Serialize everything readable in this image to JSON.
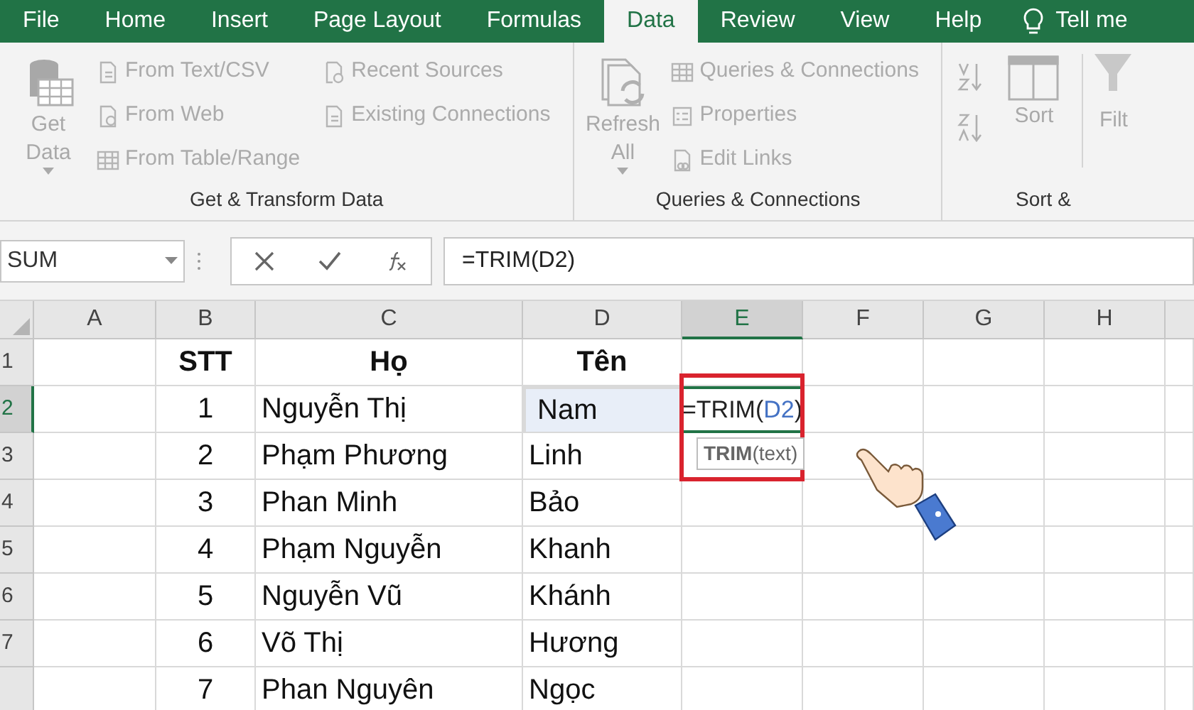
{
  "menu_tabs": [
    {
      "label": "File",
      "selected": false
    },
    {
      "label": "Home",
      "selected": false
    },
    {
      "label": "Insert",
      "selected": false
    },
    {
      "label": "Page Layout",
      "selected": false
    },
    {
      "label": "Formulas",
      "selected": false
    },
    {
      "label": "Data",
      "selected": true
    },
    {
      "label": "Review",
      "selected": false
    },
    {
      "label": "View",
      "selected": false
    },
    {
      "label": "Help",
      "selected": false
    }
  ],
  "tell_me": "Tell me",
  "ribbon_groups": [
    {
      "label": "Get & Transform Data",
      "big_button": {
        "label": "Get Data",
        "kind": "database"
      },
      "columns": [
        [
          {
            "label": "From Text/CSV",
            "kind": "file"
          },
          {
            "label": "From Web",
            "kind": "web"
          },
          {
            "label": "From Table/Range",
            "kind": "table"
          }
        ],
        [
          {
            "label": "Recent Sources",
            "kind": "clock"
          },
          {
            "label": "Existing Connections",
            "kind": "file"
          }
        ]
      ]
    },
    {
      "label": "Queries & Connections",
      "big_button": {
        "label": "Refresh All",
        "kind": "refresh"
      },
      "columns": [
        [
          {
            "label": "Queries & Connections",
            "kind": "table"
          },
          {
            "label": "Properties",
            "kind": "list"
          },
          {
            "label": "Edit Links",
            "kind": "link"
          }
        ]
      ]
    },
    {
      "label": "Sort &",
      "big_button": {
        "label": "Sort",
        "kind": "sort"
      },
      "trailing": "Filt"
    }
  ],
  "formula_bar": {
    "name_box": "SUM",
    "formula": "=TRIM(D2)"
  },
  "columns": [
    {
      "label": "A",
      "selected": false
    },
    {
      "label": "B",
      "selected": false
    },
    {
      "label": "C",
      "selected": false
    },
    {
      "label": "D",
      "selected": false
    },
    {
      "label": "E",
      "selected": true
    },
    {
      "label": "F",
      "selected": false
    },
    {
      "label": "G",
      "selected": false
    },
    {
      "label": "H",
      "selected": false
    }
  ],
  "rows": [
    {
      "number": "1",
      "selected": false,
      "stt": "STT",
      "ho": "Họ",
      "ten": "Tên",
      "header": true
    },
    {
      "number": "2",
      "selected": true,
      "stt": "1",
      "ho": "Nguyễn Thị",
      "ten": "Nam",
      "header": false,
      "entry": {
        "prefix": "=TRIM(",
        "reference": "D2",
        "suffix": ")",
        "tooltip": "**TRIM**(text)"
      }
    },
    {
      "number": "3",
      "selected": false,
      "stt": "2",
      "ho": "Phạm Phương",
      "ten": "Linh",
      "header": false
    },
    {
      "number": "4",
      "selected": false,
      "stt": "3",
      "ho": "Phan Minh",
      "ten": "Bảo",
      "header": false
    },
    {
      "number": "5",
      "selected": false,
      "stt": "4",
      "ho": "Phạm Nguyễn",
      "ten": "Khanh",
      "header": false
    },
    {
      "number": "6",
      "selected": false,
      "stt": "5",
      "ho": "Nguyễn Vũ",
      "ten": "Khánh",
      "header": false
    },
    {
      "number": "7",
      "selected": false,
      "stt": "6",
      "ho": "Võ Thị",
      "ten": "Hương",
      "header": false
    },
    {
      "selected": false,
      "stt": "7",
      "ho": "Phan Nguyên",
      "ten": "Ngọc",
      "header": false
    }
  ]
}
